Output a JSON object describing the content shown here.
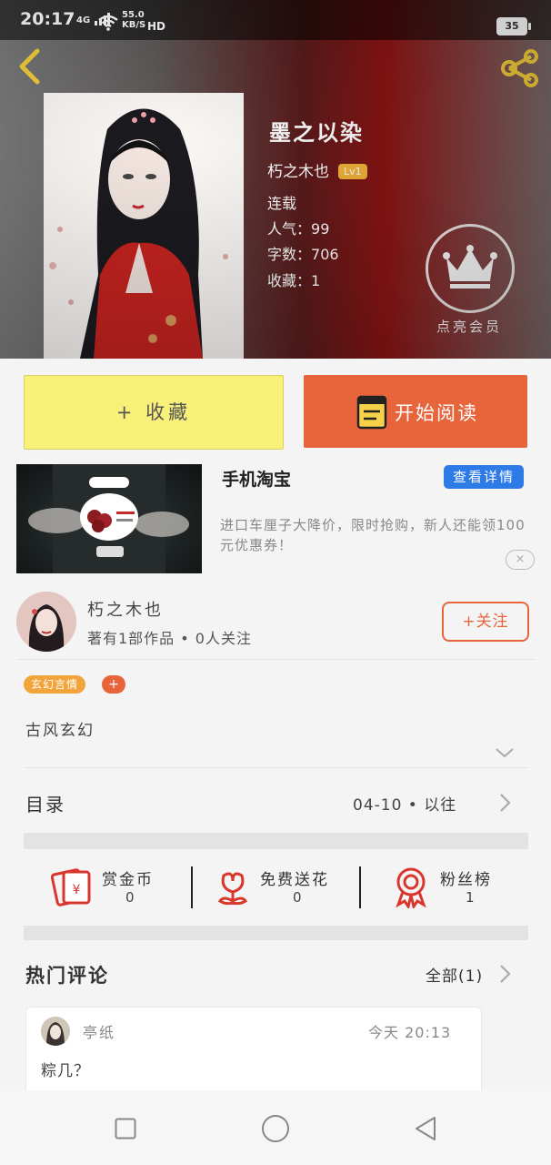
{
  "status_bar": {
    "time": "20:17",
    "network": "4G",
    "speed_value": "55.0",
    "speed_unit": "KB/S",
    "hd": "HD",
    "battery": "35"
  },
  "book": {
    "title": "墨之以染",
    "author": "朽之木也",
    "level_badge": "Lv1",
    "status": "连载",
    "popularity_label": "人气：",
    "popularity_value": "99",
    "word_count_label": "字数：",
    "word_count_value": "706",
    "collections_label": "收藏：",
    "collections_value": "1",
    "vip_label": "点亮会员"
  },
  "actions": {
    "favorite_label": "+ 收藏",
    "read_label": "开始阅读"
  },
  "ad": {
    "title": "手机淘宝",
    "detail_button": "查看详情",
    "description": "进口车厘子大降价，限时抢购，新人还能领100元优惠券！",
    "close_label": "×"
  },
  "author_card": {
    "name": "朽之木也",
    "works_text": "著有1部作品 • 0人关注",
    "follow_label": "+关注"
  },
  "tags": {
    "primary_tag": "玄幻言情",
    "add_label": "+"
  },
  "genre_text": "古风玄幻",
  "toc": {
    "label": "目录",
    "date": "04-10 • 以往"
  },
  "stats": [
    {
      "label": "赏金币",
      "value": "0",
      "icon": "red-envelope-icon"
    },
    {
      "label": "免费送花",
      "value": "0",
      "icon": "flower-icon"
    },
    {
      "label": "粉丝榜",
      "value": "1",
      "icon": "medal-icon"
    }
  ],
  "comments": {
    "section_title": "热门评论",
    "all_label": "全部(1)",
    "items": [
      {
        "user": "亭纸",
        "time": "今天 20:13",
        "text": "粽几？"
      }
    ]
  },
  "colors": {
    "accent_orange": "#e8643b",
    "fav_yellow": "#f9f07a",
    "tag_orange": "#f2a43a",
    "detail_blue": "#2e7be8"
  }
}
